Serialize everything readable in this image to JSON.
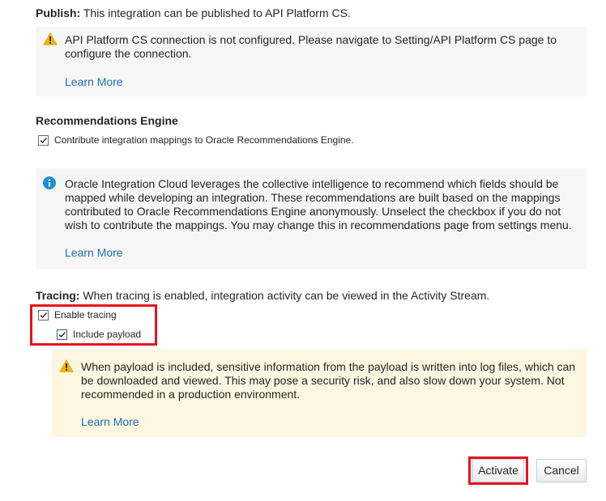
{
  "publish": {
    "label": "Publish:",
    "text": " This integration can be published to API Platform CS.",
    "warning": "API Platform CS connection is not configured. Please navigate to Setting/API Platform CS page to configure the connection.",
    "learn_more": "Learn More"
  },
  "recommendations": {
    "heading": "Recommendations Engine",
    "checkbox_label": "Contribute integration mappings to Oracle Recommendations Engine.",
    "checked": true,
    "info": "Oracle Integration Cloud leverages the collective intelligence to recommend which fields should be mapped while developing an integration. These recommendations are built based on the mappings contributed to Oracle Recommendations Engine anonymously. Unselect the checkbox if you do not wish to contribute the mappings. You may change this in recommendations page from settings menu.",
    "learn_more": "Learn More"
  },
  "tracing": {
    "label": "Tracing:",
    "text": " When tracing is enabled, integration activity can be viewed in the Activity Stream.",
    "enable_label": "Enable tracing",
    "enable_checked": true,
    "payload_label": "Include payload",
    "payload_checked": true,
    "warning": "When payload is included, sensitive information from the payload is written into log files, which can be downloaded and viewed. This may pose a security risk, and also slow down your system. Not recommended in a production environment.",
    "learn_more": "Learn More"
  },
  "footer": {
    "activate_label": "Activate",
    "cancel_label": "Cancel"
  },
  "colors": {
    "highlight": "#e5141f",
    "link": "#1f6fb5",
    "warning_icon": "#f0b400",
    "info_icon": "#1d8fd6"
  }
}
